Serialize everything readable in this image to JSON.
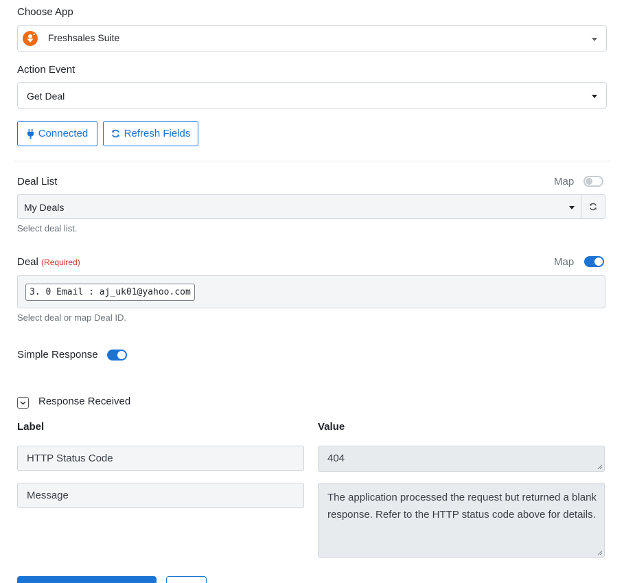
{
  "choose_app": {
    "label": "Choose App",
    "value": "Freshsales Suite"
  },
  "action_event": {
    "label": "Action Event",
    "value": "Get Deal"
  },
  "buttons": {
    "connected": "Connected",
    "refresh": "Refresh Fields"
  },
  "deal_list": {
    "label": "Deal List",
    "map_label": "Map",
    "map_enabled": false,
    "value": "My Deals",
    "help": "Select deal list."
  },
  "deal": {
    "label": "Deal",
    "required": "(Required)",
    "map_label": "Map",
    "map_enabled": true,
    "token": "3. 0 Email : aj_uk01@yahoo.com",
    "help": "Select deal or map Deal ID."
  },
  "simple_response": {
    "label": "Simple Response",
    "enabled": true
  },
  "response": {
    "title": "Response Received",
    "label_header": "Label",
    "value_header": "Value",
    "rows": [
      {
        "label": "HTTP Status Code",
        "value": "404"
      },
      {
        "label": "Message",
        "value": "The application processed the request but returned a blank response.  Refer to the HTTP status code above for details."
      }
    ]
  },
  "colors": {
    "accent": "#1b73d3",
    "required": "#c0392b",
    "app_icon": "#f26b11"
  },
  "icons": {
    "app": "freshsales-logo-icon",
    "plug": "plug-icon",
    "refresh": "refresh-icon",
    "chevron": "chevron-down-icon"
  }
}
